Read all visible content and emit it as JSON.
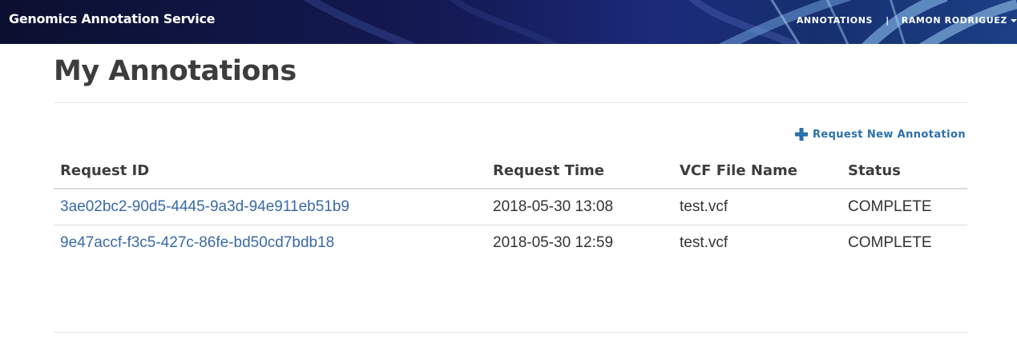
{
  "navbar": {
    "brand": "Genomics Annotation Service",
    "annotations_link": "ANNOTATIONS",
    "separator": "|",
    "user_menu": "RAMON RODRIGUEZ",
    "colors": {
      "background": "#141a55",
      "text": "#ffffff"
    }
  },
  "main": {
    "title": "My Annotations",
    "request_new_label": "Request New Annotation",
    "request_new_icon": "plus-icon",
    "table": {
      "headers": [
        "Request ID",
        "Request Time",
        "VCF File Name",
        "Status"
      ],
      "rows": [
        {
          "request_id": "3ae02bc2-90d5-4445-9a3d-94e911eb51b9",
          "request_time": "2018-05-30 13:08",
          "vcf_file_name": "test.vcf",
          "status": "COMPLETE"
        },
        {
          "request_id": "9e47accf-f3c5-427c-86fe-bd50cd7bdb18",
          "request_time": "2018-05-30 12:59",
          "vcf_file_name": "test.vcf",
          "status": "COMPLETE"
        }
      ]
    },
    "colors": {
      "link": "#3a6aa6",
      "accent": "#2b6fad",
      "heading": "#3d3d3d"
    }
  }
}
